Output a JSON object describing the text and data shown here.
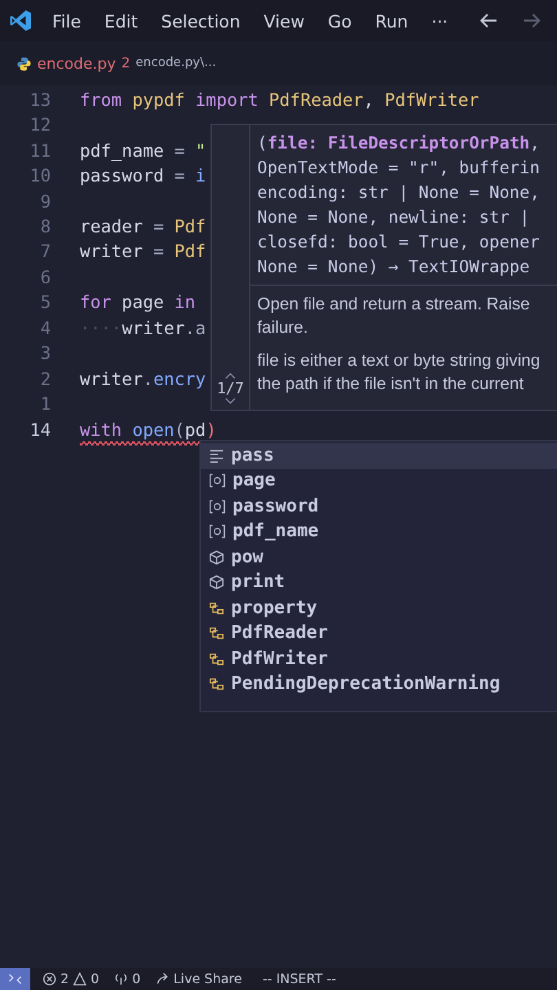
{
  "title_bar": {
    "menu": [
      "File",
      "Edit",
      "Selection",
      "View",
      "Go",
      "Run"
    ],
    "more": "···"
  },
  "tab": {
    "filename": "encode.py",
    "problems": "2",
    "breadcrumb": "encode.py\\..."
  },
  "editor": {
    "lines": [
      {
        "number": "13",
        "current": false,
        "tokens": [
          {
            "text": "from ",
            "kind": "keyword"
          },
          {
            "text": "pypdf ",
            "kind": "module"
          },
          {
            "text": "import ",
            "kind": "keyword"
          },
          {
            "text": "PdfReader",
            "kind": "class"
          },
          {
            "text": ", "
          },
          {
            "text": "PdfWriter",
            "kind": "class"
          }
        ]
      },
      {
        "number": "12",
        "current": false
      },
      {
        "number": "11",
        "current": false,
        "tokens": [
          {
            "text": "pdf_name"
          },
          {
            "text": " = ",
            "kind": "op"
          },
          {
            "text": "\"",
            "kind": "string"
          }
        ]
      },
      {
        "number": "10",
        "current": false,
        "tokens": [
          {
            "text": "password"
          },
          {
            "text": " = ",
            "kind": "op"
          },
          {
            "text": "i",
            "kind": "func"
          }
        ]
      },
      {
        "number": "9",
        "current": false
      },
      {
        "number": "8",
        "current": false,
        "tokens": [
          {
            "text": "reader"
          },
          {
            "text": " = ",
            "kind": "op"
          },
          {
            "text": "Pdf",
            "kind": "class"
          }
        ]
      },
      {
        "number": "7",
        "current": false,
        "tokens": [
          {
            "text": "writer"
          },
          {
            "text": " = ",
            "kind": "op"
          },
          {
            "text": "Pdf",
            "kind": "class"
          }
        ]
      },
      {
        "number": "6",
        "current": false
      },
      {
        "number": "5",
        "current": false,
        "tokens": [
          {
            "text": "for",
            "kind": "keyword"
          },
          {
            "text": " page "
          },
          {
            "text": "in",
            "kind": "keyword"
          }
        ]
      },
      {
        "number": "4",
        "current": false,
        "tokens": [
          {
            "text": "····",
            "kind": "whitespace"
          },
          {
            "text": "writer"
          },
          {
            "text": ".a",
            "kind": "op"
          }
        ]
      },
      {
        "number": "3",
        "current": false
      },
      {
        "number": "2",
        "current": false,
        "tokens": [
          {
            "text": "writer"
          },
          {
            "text": ".",
            "kind": "op"
          },
          {
            "text": "encry",
            "kind": "func"
          }
        ]
      },
      {
        "number": "1",
        "current": false
      },
      {
        "number": "14",
        "current": true,
        "error": true,
        "tokens": [
          {
            "text": "with ",
            "kind": "keyword"
          },
          {
            "text": "open",
            "kind": "func"
          },
          {
            "text": "(",
            "kind": "op"
          },
          {
            "text": "pd"
          },
          {
            "text": ")",
            "kind": "paren"
          }
        ]
      }
    ]
  },
  "signature_help": {
    "counter": "1/7",
    "signature": [
      "(**file: FileDescriptorOrPath**,",
      "OpenTextMode = \"r\", bufferin",
      "encoding: str | None = None,",
      "None = None, newline: str |",
      "closefd: bool = True, opener",
      "None = None) → TextIOWrappe"
    ],
    "description": [
      "Open file and return a stream. Raise",
      "failure."
    ],
    "details": [
      "file is either a text or byte string giving",
      "the path if the file isn't in the current"
    ]
  },
  "completions": [
    {
      "label": "pass",
      "kind": "snippet",
      "selected": true
    },
    {
      "label": "page",
      "kind": "variable",
      "selected": false
    },
    {
      "label": "password",
      "kind": "variable",
      "selected": false
    },
    {
      "label": "pdf_name",
      "kind": "variable",
      "selected": false
    },
    {
      "label": "pow",
      "kind": "function",
      "selected": false
    },
    {
      "label": "print",
      "kind": "function",
      "selected": false
    },
    {
      "label": "property",
      "kind": "class",
      "selected": false
    },
    {
      "label": "PdfReader",
      "kind": "class",
      "selected": false
    },
    {
      "label": "PdfWriter",
      "kind": "class",
      "selected": false
    },
    {
      "label": "PendingDeprecationWarning",
      "kind": "class",
      "selected": false
    }
  ],
  "status_bar": {
    "errors": "2",
    "warnings": "0",
    "ports": "0",
    "live_share": "Live Share",
    "mode": "-- INSERT --"
  }
}
